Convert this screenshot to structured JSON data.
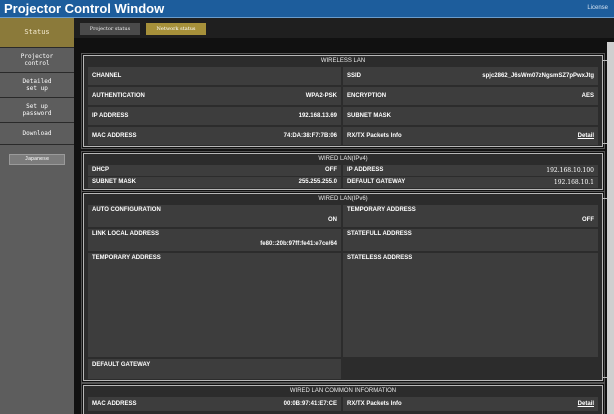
{
  "window": {
    "title": "Projector Control Window",
    "license": "License"
  },
  "sidebar": {
    "items": [
      {
        "label": "Status"
      },
      {
        "label": "Projector control"
      },
      {
        "label": "Detailed set up"
      },
      {
        "label": "Set up password"
      },
      {
        "label": "Download"
      }
    ],
    "language_button": "Japanese"
  },
  "tabs": [
    {
      "label": "Projector status"
    },
    {
      "label": "Network status"
    }
  ],
  "wireless_lan": {
    "title": "WIRELESS LAN",
    "channel_label": "CHANNEL",
    "channel_value": "",
    "ssid_label": "SSID",
    "ssid_value": "spjc2862_J6sWm07zNgsmSZ7pPwxJtg",
    "authentication_label": "AUTHENTICATION",
    "authentication_value": "WPA2-PSK",
    "encryption_label": "ENCRYPTION",
    "encryption_value": "AES",
    "ip_label": "IP ADDRESS",
    "ip_value": "192.168.13.69",
    "subnet_label": "SUBNET MASK",
    "subnet_value": "",
    "mac_label": "MAC ADDRESS",
    "mac_value": "74:DA:38:F7:7B:06",
    "rxtx_label": "RX/TX Packets Info",
    "detail_link": "Detail"
  },
  "wired_ipv4": {
    "title": "WIRED LAN(IPv4)",
    "dhcp_label": "DHCP",
    "dhcp_value": "OFF",
    "ip_label": "IP ADDRESS",
    "ip_value": "192.168.10.100",
    "subnet_label": "SUBNET MASK",
    "subnet_value": "255.255.255.0",
    "gateway_label": "DEFAULT GATEWAY",
    "gateway_value": "192.168.10.1"
  },
  "wired_ipv6": {
    "title": "WIRED LAN(IPv6)",
    "auto_config_label": "AUTO CONFIGURATION",
    "auto_config_value": "ON",
    "temp_addr_label_right": "TEMPORARY ADDRESS",
    "temp_addr_value_right": "OFF",
    "link_local_label": "LINK LOCAL ADDRESS",
    "link_local_value": "fe80::20b:97ff:fe41:e7ce/64",
    "stateful_label": "STATEFULL ADDRESS",
    "temp_addr_label_left": "TEMPORARY ADDRESS",
    "stateless_label": "STATELESS ADDRESS",
    "default_gateway_label": "DEFAULT GATEWAY"
  },
  "wired_common": {
    "title": "WIRED LAN COMMON INFORMATION",
    "mac_label": "MAC ADDRESS",
    "mac_value": "00:0B:97:41:E7:CE",
    "rxtx_label": "RX/TX Packets Info",
    "detail_link": "Detail"
  }
}
